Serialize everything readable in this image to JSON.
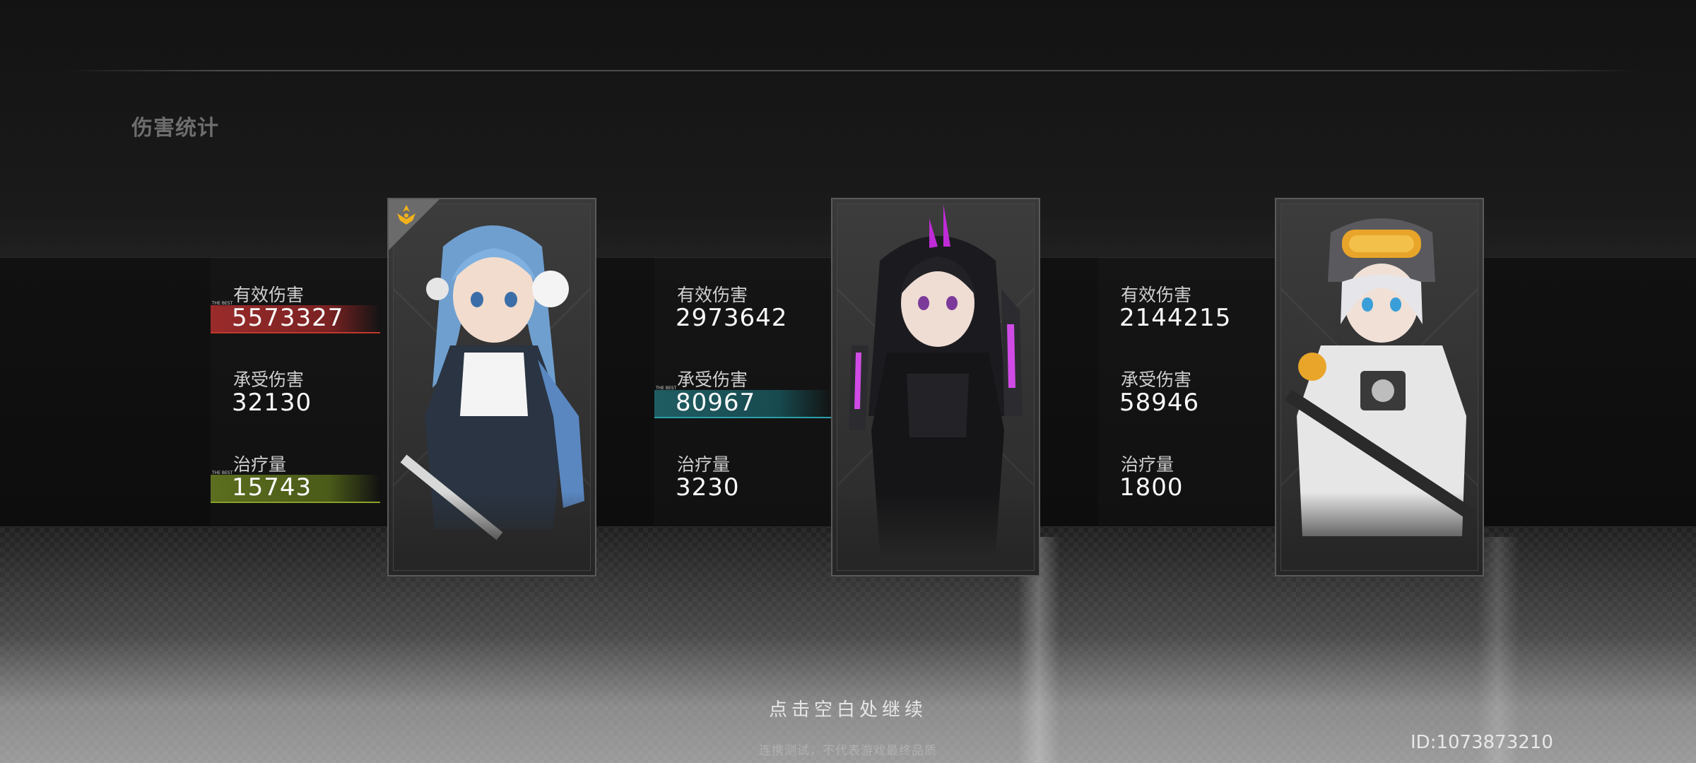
{
  "page_title": "伤害统计",
  "labels": {
    "effective_damage": "有效伤害",
    "damage_taken": "承受伤害",
    "healing": "治疗量",
    "best_tag": "THE BEST"
  },
  "characters": [
    {
      "name": "blue-hair-character",
      "effective_damage": "5573327",
      "damage_taken": "32130",
      "healing": "15743",
      "highlights": [
        "effective_damage",
        "healing"
      ],
      "leader": true
    },
    {
      "name": "black-hair-character",
      "effective_damage": "2973642",
      "damage_taken": "80967",
      "healing": "3230",
      "highlights": [
        "damage_taken"
      ],
      "leader": false
    },
    {
      "name": "white-hair-character",
      "effective_damage": "2144215",
      "damage_taken": "58946",
      "healing": "1800",
      "highlights": [],
      "leader": false
    }
  ],
  "colors": {
    "damage_best": "#9a2b2b",
    "taken_best": "#1f5d63",
    "healing_best": "#5c6e1f",
    "leader_badge": "#f2b21c"
  },
  "continue_text": "点击空白处继续",
  "disclaimer": "连携测试，不代表游戏最终品质",
  "player_id": "ID:1073873210"
}
